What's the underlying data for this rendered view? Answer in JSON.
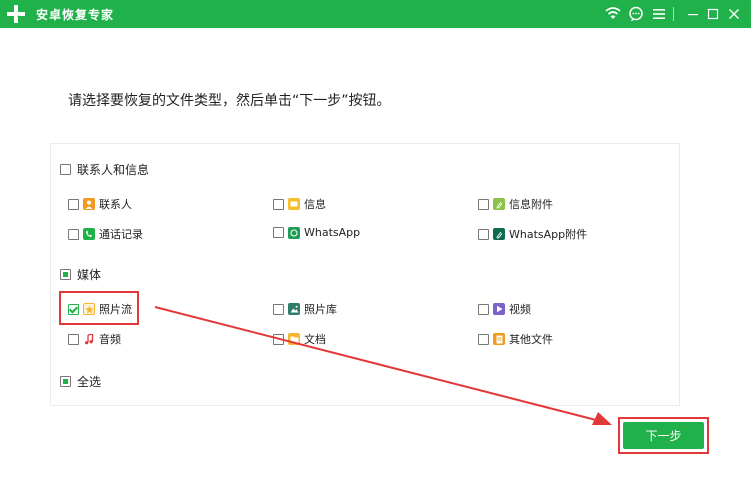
{
  "window": {
    "title": "安卓恢复专家",
    "controls": [
      "wifi-icon",
      "chat-icon",
      "menu-icon",
      "minimize-icon",
      "maximize-icon",
      "close-icon"
    ]
  },
  "instruction": "请选择要恢复的文件类型，然后单击“下一步”按钮。",
  "groups": {
    "contacts_messages": {
      "label": "联系人和信息",
      "state": "unchecked",
      "items": [
        {
          "label": "联系人",
          "checked": false,
          "icon": "contact-icon",
          "color": "#f29a1f"
        },
        {
          "label": "信息",
          "checked": false,
          "icon": "message-icon",
          "color": "#f5c02b"
        },
        {
          "label": "信息附件",
          "checked": false,
          "icon": "attachment-icon",
          "color": "#8bc34a"
        },
        {
          "label": "通话记录",
          "checked": false,
          "icon": "phone-icon",
          "color": "#20b14a"
        },
        {
          "label": "WhatsApp",
          "checked": false,
          "icon": "whatsapp-icon",
          "color": "#1f9d55"
        },
        {
          "label": "WhatsApp附件",
          "checked": false,
          "icon": "whatsapp-attachment-icon",
          "color": "#0e6b4f"
        }
      ]
    },
    "media": {
      "label": "媒体",
      "state": "partial",
      "items": [
        {
          "label": "照片流",
          "checked": true,
          "icon": "photo-stream-icon",
          "color": "#f5b731"
        },
        {
          "label": "照片库",
          "checked": false,
          "icon": "photo-library-icon",
          "color": "#2e7d6b"
        },
        {
          "label": "视频",
          "checked": false,
          "icon": "video-icon",
          "color": "#7b61c9"
        },
        {
          "label": "音频",
          "checked": false,
          "icon": "audio-icon",
          "color": "#e2383a"
        },
        {
          "label": "文档",
          "checked": false,
          "icon": "document-icon",
          "color": "#f5b731"
        },
        {
          "label": "其他文件",
          "checked": false,
          "icon": "other-file-icon",
          "color": "#f29a1f"
        }
      ]
    }
  },
  "select_all": {
    "label": "全选",
    "state": "partial"
  },
  "next_button": {
    "label": "下一步"
  },
  "colors": {
    "brand": "#20b14a",
    "highlight": "#e2383a"
  }
}
